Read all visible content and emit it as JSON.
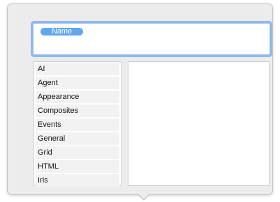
{
  "name_field": {
    "token_label": "Name"
  },
  "categories": [
    {
      "label": "AI"
    },
    {
      "label": "Agent"
    },
    {
      "label": "Appearance"
    },
    {
      "label": "Composites"
    },
    {
      "label": "Events"
    },
    {
      "label": "General"
    },
    {
      "label": "Grid"
    },
    {
      "label": "HTML"
    },
    {
      "label": "Iris"
    }
  ],
  "colors": {
    "token": "#62a7ec",
    "focus_ring": "#8fb9ee",
    "popover_bg": "#ececec"
  }
}
